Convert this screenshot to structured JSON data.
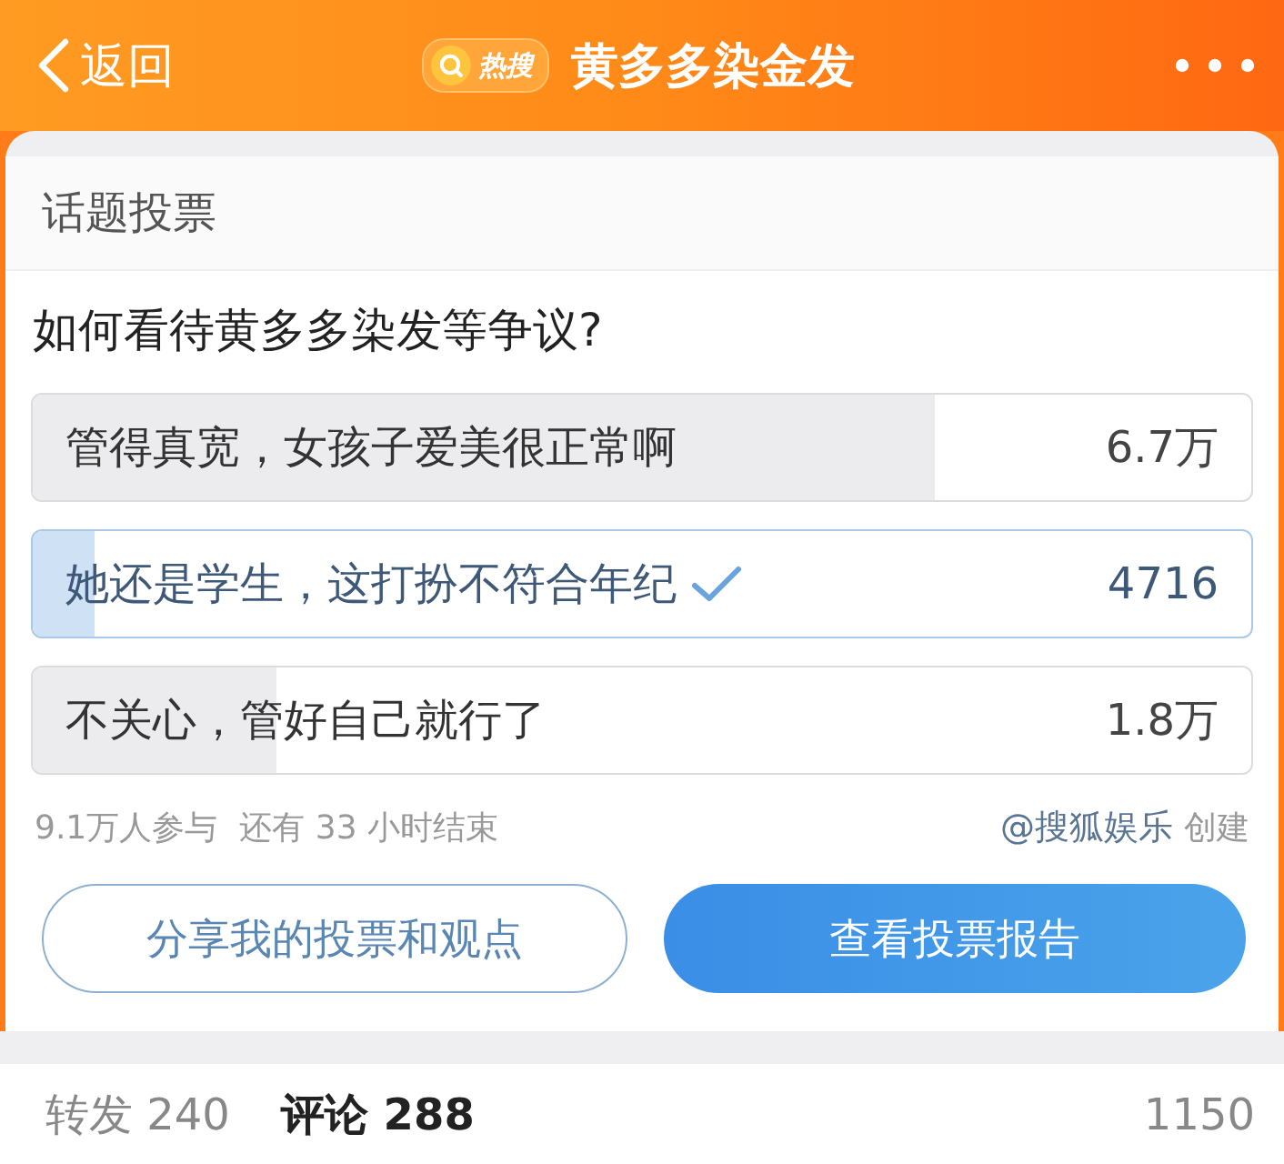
{
  "nav": {
    "back": "返回",
    "badge": "热搜",
    "title": "黄多多染金发"
  },
  "poll": {
    "header": "话题投票",
    "question": "如何看待黄多多染发等争议?",
    "options": [
      {
        "label": "管得真宽，女孩子爱美很正常啊",
        "count": "6.7万",
        "level": 0.74,
        "selected": false
      },
      {
        "label": "她还是学生，这打扮不符合年纪",
        "count": "4716",
        "level": 0.05,
        "selected": true
      },
      {
        "label": "不关心，管好自己就行了",
        "count": "1.8万",
        "level": 0.2,
        "selected": false
      }
    ],
    "participants": "9.1万人参与",
    "remaining": "还有 33 小时结束",
    "creator": "@搜狐娱乐",
    "created": "创建",
    "buttons": [
      {
        "label": "分享我的投票和观点",
        "kind": "outline"
      },
      {
        "label": "查看投票报告",
        "kind": "primary"
      }
    ]
  },
  "stats": [
    {
      "label": "转发",
      "count": "240",
      "selected": false
    },
    {
      "label": "评论",
      "count": "288",
      "selected": true
    },
    {
      "count": "1150",
      "selected": false
    }
  ]
}
